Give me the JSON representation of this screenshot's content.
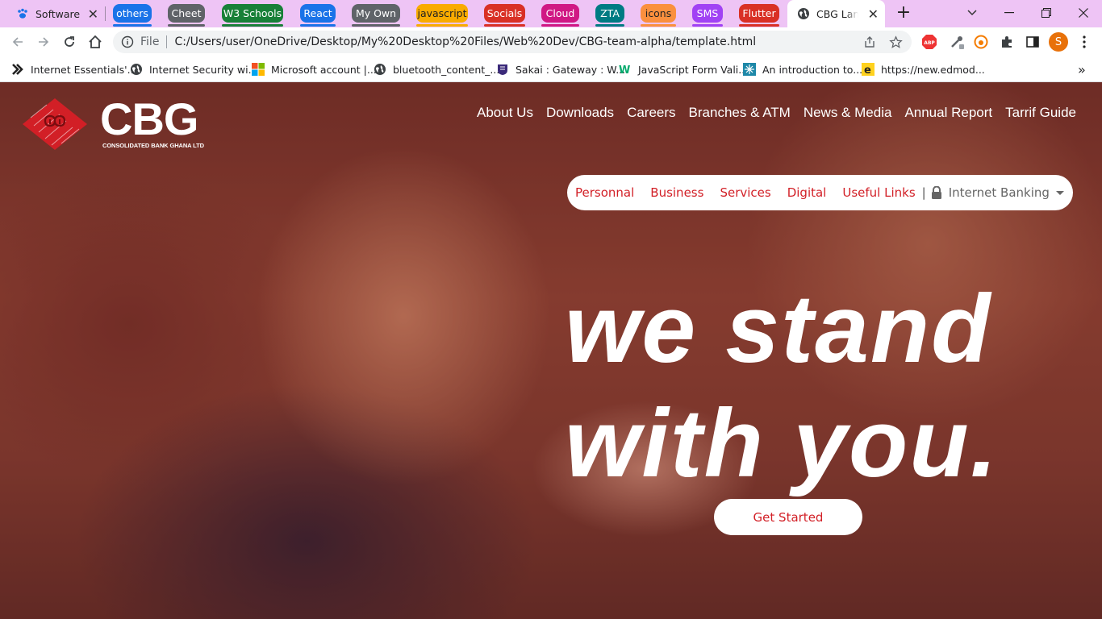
{
  "browser": {
    "first_tab": {
      "label": "Software",
      "icon": "paw-icon"
    },
    "tab_groups": [
      {
        "label": "others",
        "color": "#1a73e8"
      },
      {
        "label": "Cheet",
        "color": "#5f6368"
      },
      {
        "label": "W3 Schools",
        "color": "#188038"
      },
      {
        "label": "React",
        "color": "#1a73e8"
      },
      {
        "label": "My Own",
        "color": "#5f6368"
      },
      {
        "label": "javascript",
        "color": "#f9ab00"
      },
      {
        "label": "Socials",
        "color": "#d93025"
      },
      {
        "label": "Cloud",
        "color": "#d01884"
      },
      {
        "label": "ZTA",
        "color": "#007b83"
      },
      {
        "label": "icons",
        "color": "#fa903e"
      },
      {
        "label": "SMS",
        "color": "#a142f4"
      },
      {
        "label": "Flutter",
        "color": "#d93025"
      }
    ],
    "active_tab": {
      "label": "CBG Landing",
      "icon": "globe-icon"
    },
    "omnibox": {
      "scheme_label": "File",
      "url": "C:/Users/user/OneDrive/Desktop/My%20Desktop%20Files/Web%20Dev/CBG-team-alpha/template.html"
    },
    "profile_initial": "S",
    "bookmarks": [
      {
        "label": "Internet Essentials'...",
        "icon": "none"
      },
      {
        "label": "Internet Security wi...",
        "icon": "globe-icon"
      },
      {
        "label": "Microsoft account |...",
        "icon": "microsoft-icon"
      },
      {
        "label": "bluetooth_content_...",
        "icon": "globe-icon"
      },
      {
        "label": "Sakai : Gateway : W...",
        "icon": "sakai-icon"
      },
      {
        "label": "JavaScript Form Vali...",
        "icon": "w3-icon"
      },
      {
        "label": "An introduction to...",
        "icon": "snowflake-icon"
      },
      {
        "label": "https://new.edmod...",
        "icon": "edmodo-icon"
      }
    ]
  },
  "site": {
    "logo": {
      "brand": "CBG",
      "tagline": "CONSOLIDATED BANK GHANA LTD",
      "color": "#d21f26"
    },
    "top_nav": [
      "About Us",
      "Downloads",
      "Careers",
      "Branches & ATM",
      "News & Media",
      "Annual Report",
      "Tarrif Guide"
    ],
    "pill_nav": {
      "items": [
        "Personnal",
        "Business",
        "Services",
        "Digital",
        "Useful Links"
      ],
      "separator": "|",
      "internet_banking": "Internet Banking"
    },
    "hero": {
      "line1": "we stand",
      "line2": "with you."
    },
    "cta": "Get Started",
    "accent": "#d21f26"
  }
}
